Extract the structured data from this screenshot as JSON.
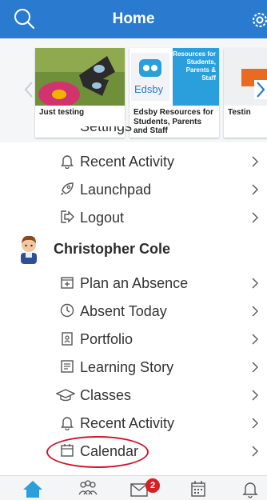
{
  "header": {
    "title": "Home"
  },
  "carousel": {
    "cards": [
      {
        "caption": "Just testing"
      },
      {
        "caption": "Edsby Resources for Students, Parents and Staff",
        "thumb_logo": "Edsby",
        "thumb_text": "Resources for Students, Parents & Staff"
      },
      {
        "caption": "Testin"
      }
    ]
  },
  "menu": {
    "partial_item": "Settings",
    "items_top": [
      {
        "icon": "bell-icon",
        "label": "Recent Activity"
      },
      {
        "icon": "rocket-icon",
        "label": "Launchpad"
      },
      {
        "icon": "logout-icon",
        "label": "Logout"
      }
    ],
    "user": {
      "name": "Christopher Cole"
    },
    "items_user": [
      {
        "icon": "plan-absence-icon",
        "label": "Plan an Absence"
      },
      {
        "icon": "clock-icon",
        "label": "Absent Today"
      },
      {
        "icon": "portfolio-icon",
        "label": "Portfolio"
      },
      {
        "icon": "learning-story-icon",
        "label": "Learning Story"
      },
      {
        "icon": "graduation-cap-icon",
        "label": "Classes"
      },
      {
        "icon": "bell-icon",
        "label": "Recent Activity"
      },
      {
        "icon": "calendar-icon",
        "label": "Calendar"
      }
    ]
  },
  "tabbar": {
    "tabs": [
      {
        "icon": "home-icon",
        "active": true
      },
      {
        "icon": "people-icon"
      },
      {
        "icon": "mail-icon",
        "badge": "2"
      },
      {
        "icon": "calendar-grid-icon"
      },
      {
        "icon": "bell-icon"
      }
    ]
  },
  "colors": {
    "brand": "#2a7bd0",
    "highlight": "#d2142a",
    "badge": "#d61f26"
  }
}
